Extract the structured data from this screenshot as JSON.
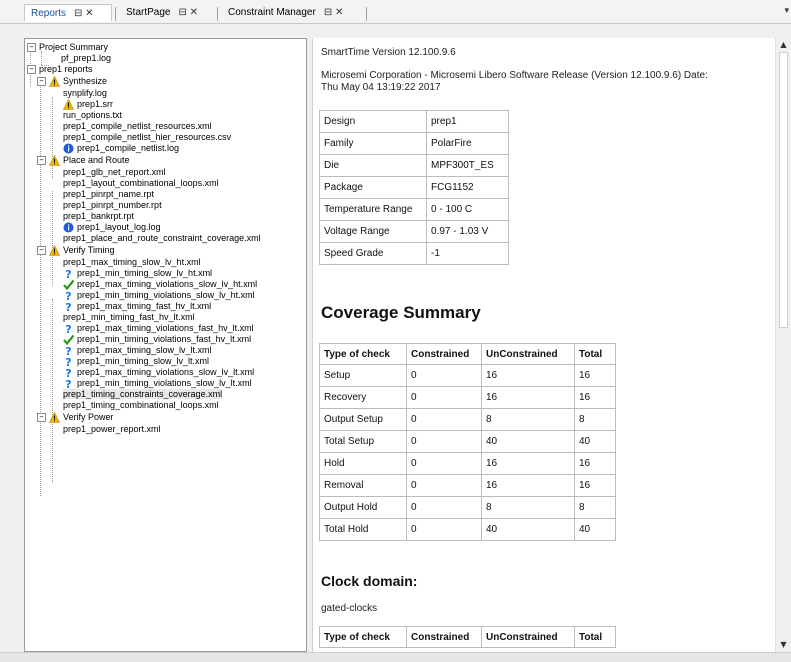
{
  "tabs": [
    {
      "label": "Reports",
      "controls": "⊟ ✕",
      "active": true
    },
    {
      "label": "StartPage",
      "controls": "⊟ ✕",
      "active": false
    },
    {
      "label": "Constraint Manager",
      "controls": "⊟ ✕",
      "active": false
    }
  ],
  "tree": {
    "project_summary": "Project Summary",
    "pf_log": "pf_prep1.log",
    "prep1_reports": "prep1 reports",
    "synthesize": "Synthesize",
    "synplify_log": "synplify.log",
    "prep1_srr": "prep1.srr",
    "run_options": "run_options.txt",
    "compile_netlist_resources": "prep1_compile_netlist_resources.xml",
    "compile_netlist_hier": "prep1_compile_netlist_hier_resources.csv",
    "compile_netlist_log": "prep1_compile_netlist.log",
    "place_and_route": "Place and Route",
    "glb_net_report": "prep1_glb_net_report.xml",
    "layout_comb_loops": "prep1_layout_combinational_loops.xml",
    "pinrpt_name": "prep1_pinrpt_name.rpt",
    "pinrpt_number": "prep1_pinrpt_number.rpt",
    "bankrpt": "prep1_bankrpt.rpt",
    "layout_log": "prep1_layout_log.log",
    "pr_constraint_cov": "prep1_place_and_route_constraint_coverage.xml",
    "verify_timing": "Verify Timing",
    "t1": "prep1_max_timing_slow_lv_ht.xml",
    "t2": "prep1_min_timing_slow_lv_ht.xml",
    "t3": "prep1_max_timing_violations_slow_lv_ht.xml",
    "t4": "prep1_min_timing_violations_slow_lv_ht.xml",
    "t5": "prep1_max_timing_fast_hv_lt.xml",
    "t6": "prep1_min_timing_fast_hv_lt.xml",
    "t7": "prep1_max_timing_violations_fast_hv_lt.xml",
    "t8": "prep1_min_timing_violations_fast_hv_lt.xml",
    "t9": "prep1_max_timing_slow_lv_lt.xml",
    "t10": "prep1_min_timing_slow_lv_lt.xml",
    "t11": "prep1_max_timing_violations_slow_lv_lt.xml",
    "t12": "prep1_min_timing_violations_slow_lv_lt.xml",
    "timing_constraints_cov": "prep1_timing_constraints_coverage.xml",
    "timing_comb_loops": "prep1_timing_combinational_loops.xml",
    "verify_power": "Verify Power",
    "power_report": "prep1_power_report.xml"
  },
  "report": {
    "version_line": "SmartTime Version 12.100.9.6",
    "corp_line1": "Microsemi Corporation - Microsemi Libero Software Release (Version 12.100.9.6) Date:",
    "corp_line2": "Thu May 04 13:19:22 2017",
    "info_table": [
      [
        "Design",
        "prep1"
      ],
      [
        "Family",
        "PolarFire"
      ],
      [
        "Die",
        "MPF300T_ES"
      ],
      [
        "Package",
        "FCG1152"
      ],
      [
        "Temperature Range",
        "0 - 100 C"
      ],
      [
        "Voltage Range",
        "0.97 - 1.03 V"
      ],
      [
        "Speed Grade",
        "-1"
      ]
    ],
    "coverage_heading": "Coverage Summary",
    "coverage_headers": [
      "Type of check",
      "Constrained",
      "UnConstrained",
      "Total"
    ],
    "coverage_rows": [
      [
        "Setup",
        "0",
        "16",
        "16"
      ],
      [
        "Recovery",
        "0",
        "16",
        "16"
      ],
      [
        "Output Setup",
        "0",
        "8",
        "8"
      ],
      [
        "Total Setup",
        "0",
        "40",
        "40"
      ],
      [
        "Hold",
        "0",
        "16",
        "16"
      ],
      [
        "Removal",
        "0",
        "16",
        "16"
      ],
      [
        "Output Hold",
        "0",
        "8",
        "8"
      ],
      [
        "Total Hold",
        "0",
        "40",
        "40"
      ]
    ],
    "clock_heading": "Clock domain:",
    "clock_name": "gated-clocks",
    "clock_headers": [
      "Type of check",
      "Constrained",
      "UnConstrained",
      "Total"
    ]
  },
  "icons": {
    "warning": "warning-icon",
    "info": "info-icon",
    "question": "question-icon",
    "check": "check-icon"
  },
  "colors": {
    "warning": "#f2b705",
    "info": "#1e5bd6",
    "question": "#1e73e8",
    "check": "#2e9a1d",
    "active_tab_text": "#1a4fa0"
  }
}
